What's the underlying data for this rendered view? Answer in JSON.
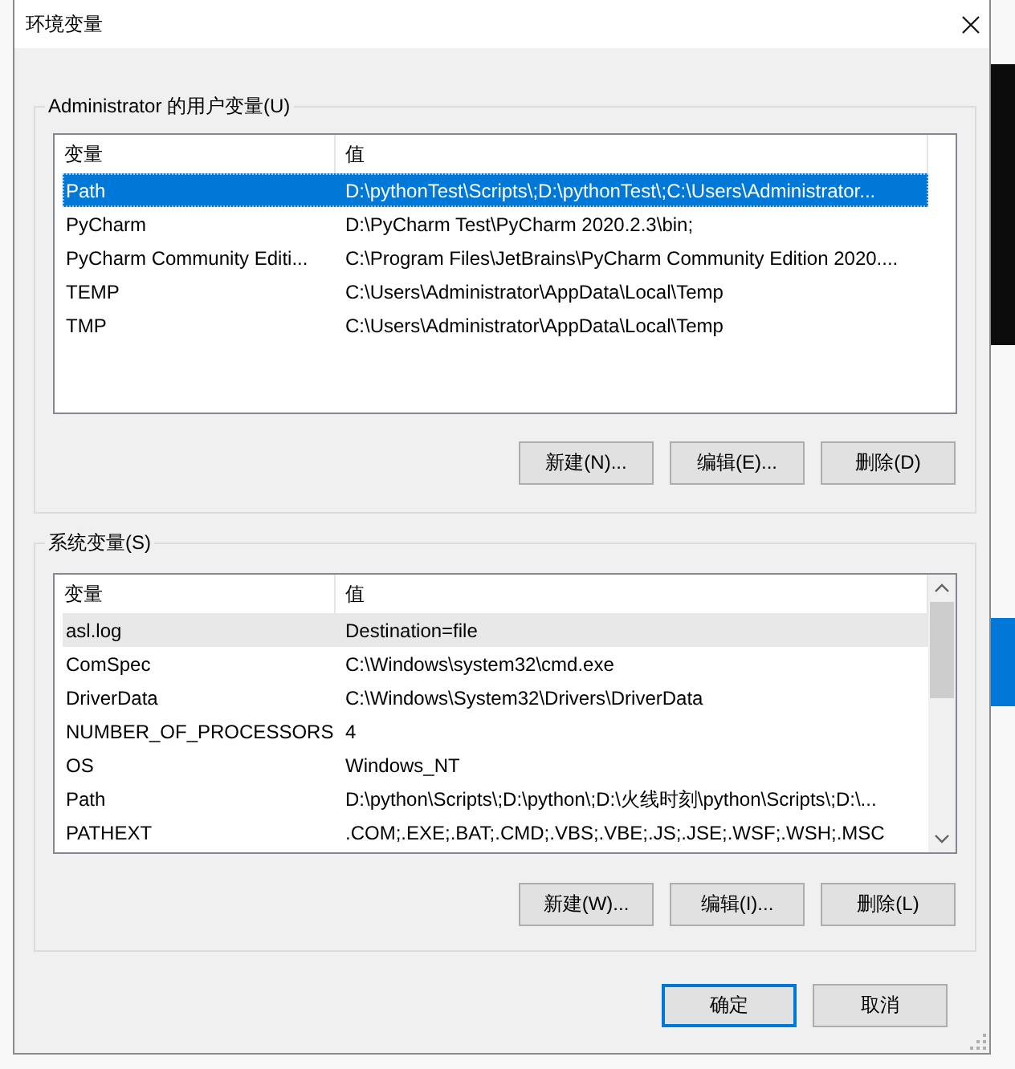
{
  "window": {
    "title": "环境变量"
  },
  "groups": [
    {
      "label": "Administrator 的用户变量(U)",
      "focused": true,
      "scrollbar": false,
      "columns": [
        "变量",
        "值"
      ],
      "rows": [
        {
          "name": "Path",
          "value": "D:\\pythonTest\\Scripts\\;D:\\pythonTest\\;C:\\Users\\Administrator...",
          "selected": true
        },
        {
          "name": "PyCharm",
          "value": "D:\\PyCharm Test\\PyCharm 2020.2.3\\bin;",
          "selected": false
        },
        {
          "name": "PyCharm Community Editi...",
          "value": "C:\\Program Files\\JetBrains\\PyCharm Community Edition 2020....",
          "selected": false
        },
        {
          "name": "TEMP",
          "value": "C:\\Users\\Administrator\\AppData\\Local\\Temp",
          "selected": false
        },
        {
          "name": "TMP",
          "value": "C:\\Users\\Administrator\\AppData\\Local\\Temp",
          "selected": false
        }
      ],
      "buttons": [
        "新建(N)...",
        "编辑(E)...",
        "删除(D)"
      ]
    },
    {
      "label": "系统变量(S)",
      "focused": false,
      "scrollbar": true,
      "columns": [
        "变量",
        "值"
      ],
      "rows": [
        {
          "name": "asl.log",
          "value": "Destination=file",
          "selected": true
        },
        {
          "name": "ComSpec",
          "value": "C:\\Windows\\system32\\cmd.exe",
          "selected": false
        },
        {
          "name": "DriverData",
          "value": "C:\\Windows\\System32\\Drivers\\DriverData",
          "selected": false
        },
        {
          "name": "NUMBER_OF_PROCESSORS",
          "value": "4",
          "selected": false
        },
        {
          "name": "OS",
          "value": "Windows_NT",
          "selected": false
        },
        {
          "name": "Path",
          "value": "D:\\python\\Scripts\\;D:\\python\\;D:\\火线时刻\\python\\Scripts\\;D:\\...",
          "selected": false
        },
        {
          "name": "PATHEXT",
          "value": ".COM;.EXE;.BAT;.CMD;.VBS;.VBE;.JS;.JSE;.WSF;.WSH;.MSC",
          "selected": false
        }
      ],
      "buttons": [
        "新建(W)...",
        "编辑(I)...",
        "删除(L)"
      ]
    }
  ],
  "footer_buttons": [
    {
      "label": "确定",
      "default": true
    },
    {
      "label": "取消",
      "default": false
    }
  ]
}
